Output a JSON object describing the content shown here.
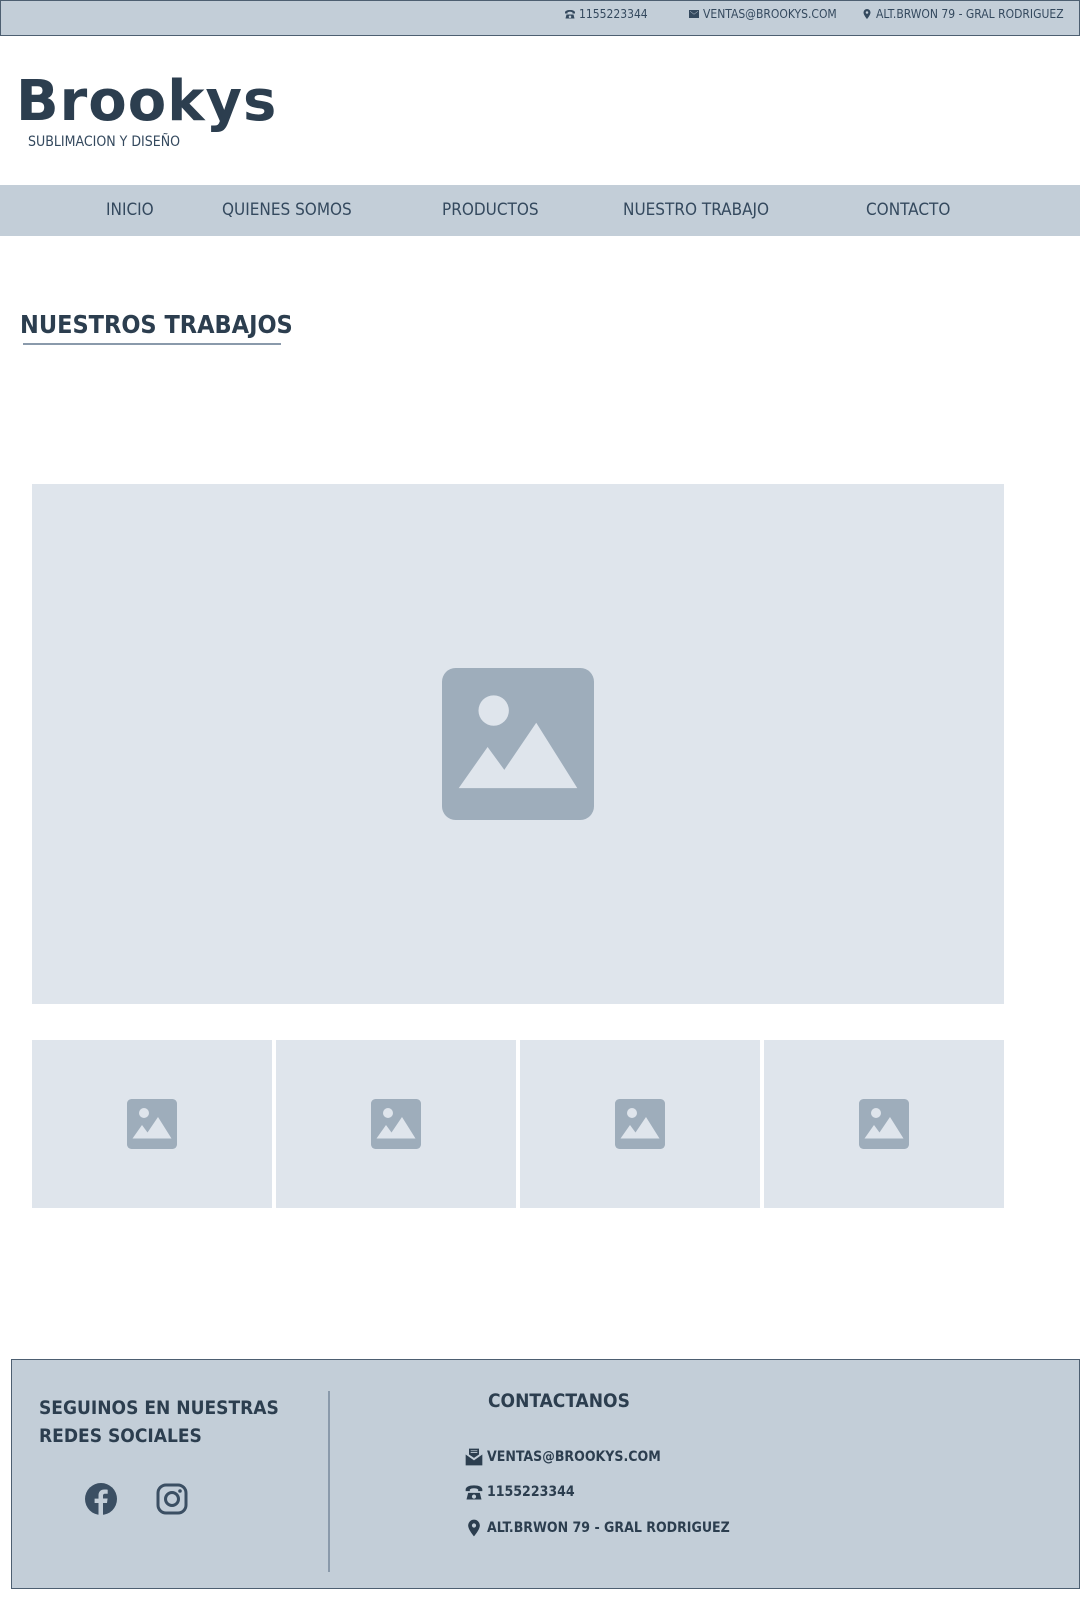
{
  "topbar": {
    "phone": "1155223344",
    "email": "VENTAS@BROOKYS.COM",
    "address": "ALT.BRWON 79 - GRAL RODRIGUEZ",
    "phone_icon": "phone-icon",
    "email_icon": "mail-icon",
    "address_icon": "location-pin-icon"
  },
  "logo": {
    "title": "Brookys",
    "subtitle": "SUBLIMACION Y DISEÑO"
  },
  "nav": {
    "items": [
      {
        "label": "INICIO"
      },
      {
        "label": "QUIENES SOMOS"
      },
      {
        "label": "PRODUCTOS"
      },
      {
        "label": "NUESTRO TRABAJO"
      },
      {
        "label": "CONTACTO"
      }
    ]
  },
  "main": {
    "title": "NUESTROS TRABAJOS",
    "main_image_icon": "image-placeholder-icon",
    "thumbnail_icons": [
      "image-placeholder-icon",
      "image-placeholder-icon",
      "image-placeholder-icon",
      "image-placeholder-icon"
    ]
  },
  "footer": {
    "social": {
      "title_line1": "SEGUINOS EN NUESTRAS",
      "title_line2": "REDES SOCIALES",
      "icons": [
        "facebook-icon",
        "instagram-icon"
      ]
    },
    "contact": {
      "title": "CONTACTANOS",
      "email": "VENTAS@BROOKYS.COM",
      "phone": "1155223344",
      "address": "ALT.BRWON 79 - GRAL RODRIGUEZ"
    }
  },
  "colors": {
    "bar_bg": "#c3ced8",
    "text_dark": "#2c3e4f",
    "placeholder_bg": "#dfe5ec",
    "placeholder_icon": "#9eadbb"
  }
}
